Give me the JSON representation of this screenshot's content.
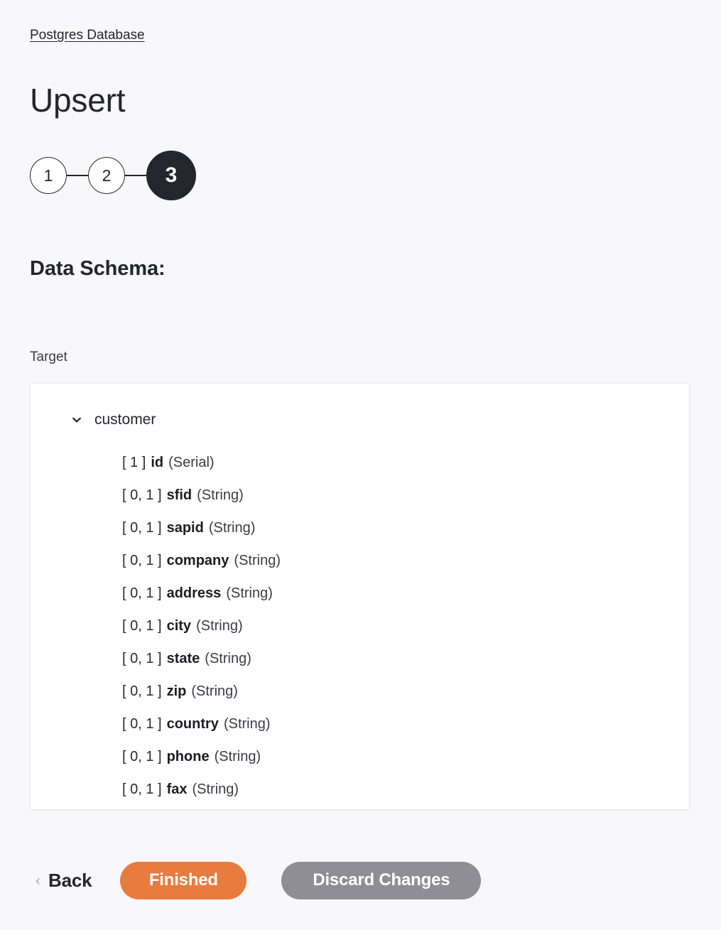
{
  "breadcrumb": {
    "label": "Postgres Database"
  },
  "header": {
    "title": "Upsert"
  },
  "stepper": {
    "steps": [
      {
        "label": "1",
        "active": false
      },
      {
        "label": "2",
        "active": false
      },
      {
        "label": "3",
        "active": true
      }
    ]
  },
  "schema_section": {
    "heading": "Data Schema:",
    "target_label": "Target",
    "tree": {
      "chevron": "chevron-down-icon",
      "node_label": "customer",
      "fields": [
        {
          "cardinality": "[ 1 ]",
          "name": "id",
          "type": "(Serial)"
        },
        {
          "cardinality": "[ 0, 1 ]",
          "name": "sfid",
          "type": "(String)"
        },
        {
          "cardinality": "[ 0, 1 ]",
          "name": "sapid",
          "type": "(String)"
        },
        {
          "cardinality": "[ 0, 1 ]",
          "name": "company",
          "type": "(String)"
        },
        {
          "cardinality": "[ 0, 1 ]",
          "name": "address",
          "type": "(String)"
        },
        {
          "cardinality": "[ 0, 1 ]",
          "name": "city",
          "type": "(String)"
        },
        {
          "cardinality": "[ 0, 1 ]",
          "name": "state",
          "type": "(String)"
        },
        {
          "cardinality": "[ 0, 1 ]",
          "name": "zip",
          "type": "(String)"
        },
        {
          "cardinality": "[ 0, 1 ]",
          "name": "country",
          "type": "(String)"
        },
        {
          "cardinality": "[ 0, 1 ]",
          "name": "phone",
          "type": "(String)"
        },
        {
          "cardinality": "[ 0, 1 ]",
          "name": "fax",
          "type": "(String)"
        }
      ]
    }
  },
  "actions": {
    "back_icon": "chevron-left-icon",
    "back_label": "Back",
    "finished_label": "Finished",
    "discard_label": "Discard Changes"
  },
  "colors": {
    "background": "#f8f8fb",
    "panel": "#ffffff",
    "ink": "#25252d",
    "primary": "#e87b3e",
    "secondary": "#8e8e94"
  }
}
